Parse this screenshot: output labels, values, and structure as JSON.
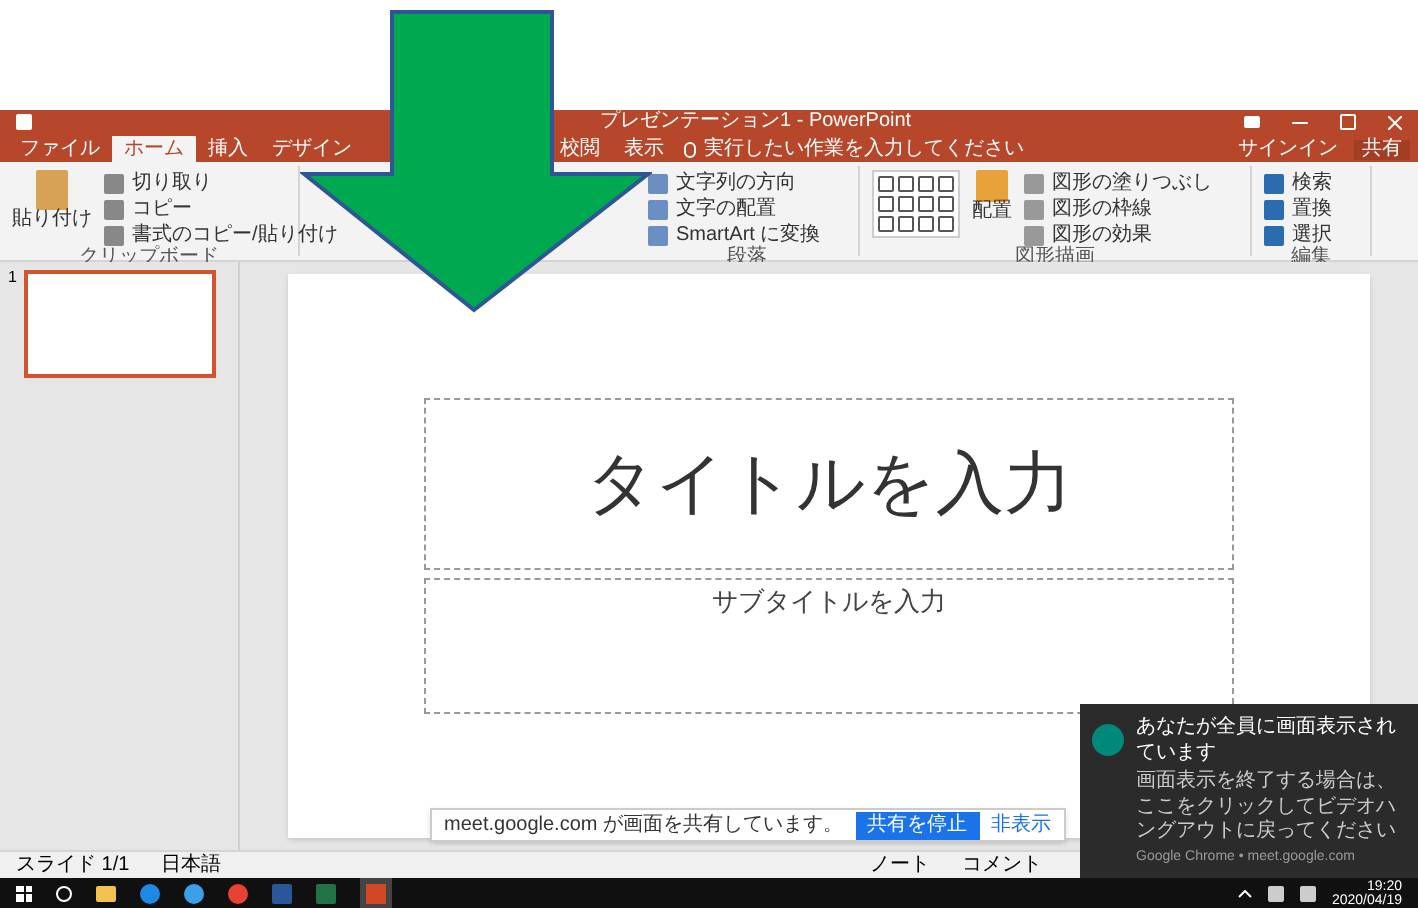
{
  "window": {
    "title": "プレゼンテーション1 - PowerPoint"
  },
  "tabs": [
    {
      "label": "ファイル",
      "selected": false
    },
    {
      "label": "ホーム",
      "selected": true
    },
    {
      "label": "挿入",
      "selected": false
    },
    {
      "label": "デザイン",
      "selected": false
    },
    {
      "label": "校閲",
      "selected": false
    },
    {
      "label": "表示",
      "selected": false
    }
  ],
  "tell_me": {
    "placeholder": "実行したい作業を入力してください"
  },
  "account": {
    "sign_in": "サインイン",
    "share": "共有"
  },
  "ribbon": {
    "clipboard": {
      "paste": "貼り付け",
      "items": [
        "切り取り",
        "コピー",
        "書式のコピー/貼り付け"
      ],
      "label": "クリップボード"
    },
    "paragraph": {
      "items": [
        "文字列の方向",
        "文字の配置",
        "SmartArt に変換"
      ],
      "label": "段落"
    },
    "drawing": {
      "arrange": "配置",
      "items": [
        "図形の塗りつぶし",
        "図形の枠線",
        "図形の効果"
      ],
      "label": "図形描画"
    },
    "editing": {
      "items": [
        "検索",
        "置換",
        "選択"
      ],
      "label": "編集"
    }
  },
  "thumbnails": [
    {
      "number": "1",
      "selected": true
    }
  ],
  "slide": {
    "title_placeholder": "タイトルを入力",
    "subtitle_placeholder": "サブタイトルを入力"
  },
  "status_bar": {
    "slide": "スライド 1/1",
    "language": "日本語",
    "notes": "ノート",
    "comments": "コメント"
  },
  "share_bar": {
    "message": "meet.google.com が画面を共有しています。",
    "stop": "共有を停止",
    "hide": "非表示"
  },
  "toast": {
    "title": "あなたが全員に画面表示されています",
    "body": "画面表示を終了する場合は、ここをクリックしてビデオハングアウトに戻ってください",
    "source": "Google Chrome • meet.google.com"
  },
  "taskbar": {
    "time": "19:20",
    "date": "2020/04/19"
  }
}
